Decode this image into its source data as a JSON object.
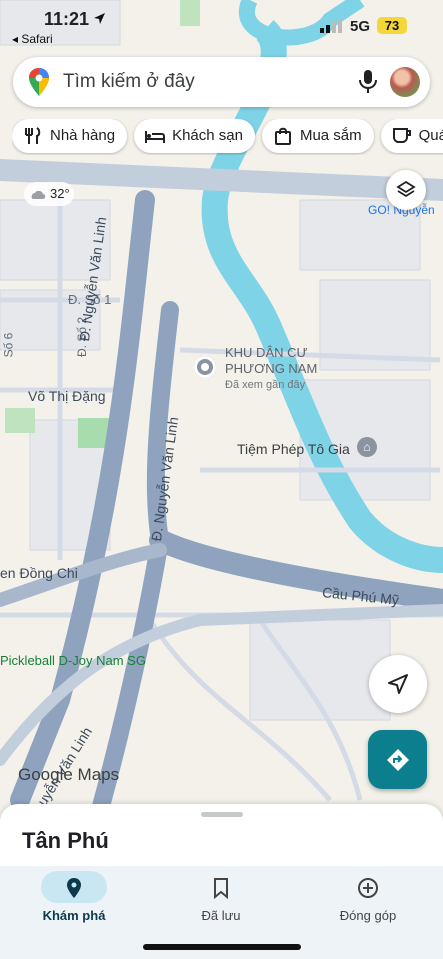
{
  "status": {
    "time": "11:21",
    "back_app": "◂ Safari",
    "network": "5G",
    "battery": "73"
  },
  "search": {
    "placeholder": "Tìm kiếm ở đây"
  },
  "chips": [
    {
      "label": "Nhà hàng",
      "icon": "fork-knife-icon"
    },
    {
      "label": "Khách sạn",
      "icon": "bed-icon"
    },
    {
      "label": "Mua sắm",
      "icon": "shopping-bag-icon"
    },
    {
      "label": "Quán",
      "icon": "coffee-cup-icon"
    }
  ],
  "weather": {
    "temp": "32°",
    "icon": "cloud-icon"
  },
  "map_labels": {
    "go": "GO! Nguyễn",
    "d_so_1": "Đ. Số 1",
    "so_6": "Số 6",
    "d_so_2": "Đ. Số 2",
    "vo_thi_dang": "Võ Thị Đặng",
    "nguyen_van_linh_1": "Đ. Nguyễn Văn Linh",
    "nguyen_van_linh_2": "Đ. Nguyễn Văn Linh",
    "khu_dan_cu": "KHU DÂN CƯ",
    "phuong_nam": "PHƯƠNG NAM",
    "da_xem": "Đã xem gần đây",
    "tiem_phep": "Tiệm Phép Tô Gia",
    "dong_chi": "en Đồng Chi",
    "cau_phu_my": "Cầu Phú Mỹ",
    "pickleball": "Pickleball D-Joy Nam SG",
    "uyen_van_linh": "uyễn Văn Linh",
    "google_maps": "Google Maps"
  },
  "sheet": {
    "place": "Tân Phú"
  },
  "tabs": [
    {
      "label": "Khám phá",
      "icon": "explore-pin-icon",
      "active": true
    },
    {
      "label": "Đã lưu",
      "icon": "bookmark-icon",
      "active": false
    },
    {
      "label": "Đóng góp",
      "icon": "add-circle-icon",
      "active": false
    }
  ],
  "colors": {
    "accent": "#0b7f8d",
    "water": "#7fd3e6",
    "road": "#8fa3bf",
    "active_pill": "#c9e7f3"
  }
}
